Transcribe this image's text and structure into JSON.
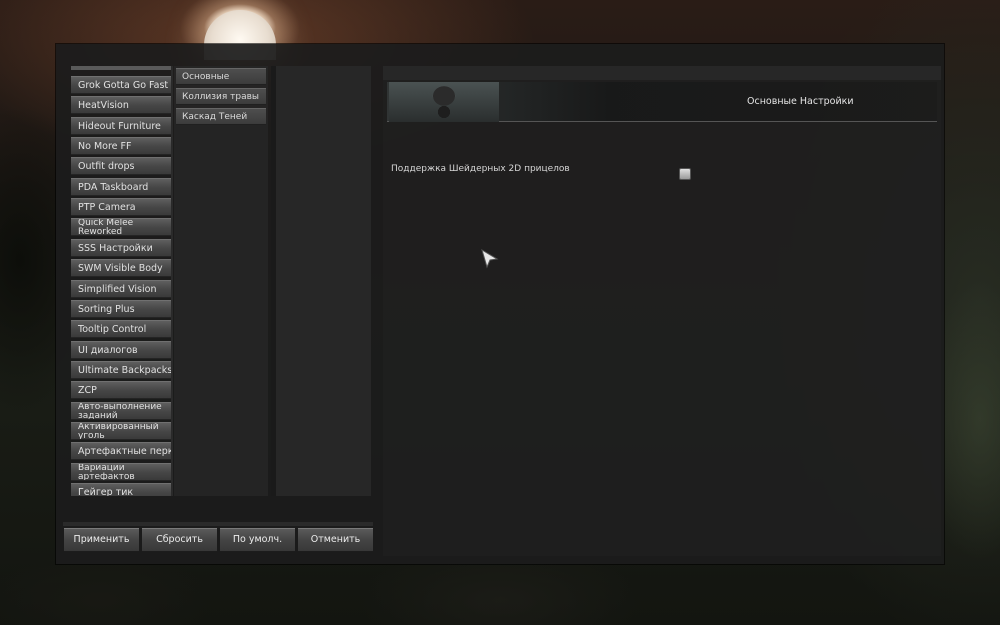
{
  "mods": [
    "Grok Gotta Go Fast",
    "HeatVision",
    "Hideout Furniture",
    "No More FF",
    "Outfit drops",
    "PDA Taskboard",
    "PTP Camera",
    [
      "Quick Melee",
      "Reworked"
    ],
    "SSS Настройки",
    "SWM Visible Body",
    "Simplified Vision",
    "Sorting Plus",
    "Tooltip Control",
    "UI диалогов",
    "Ultimate Backpacks",
    "ZCP",
    [
      "Авто-выполнение",
      "заданий"
    ],
    [
      "Активированный",
      "уголь"
    ],
    "Артефактные перки",
    [
      "Вариации",
      "артефактов"
    ],
    "Гейгер тик"
  ],
  "sub_categories": [
    "Основные",
    "Коллизия травы",
    "Каскад Теней"
  ],
  "panel": {
    "title": "Основные Настройки",
    "option_label": "Поддержка Шейдерных 2D прицелов",
    "option_checked": false
  },
  "footer": {
    "apply": "Применить",
    "reset": "Сбросить",
    "defaults": "По умолч.",
    "cancel": "Отменить"
  },
  "icons": {
    "cursor": "arrow-pointer-icon",
    "banner": "gas-mask-icon"
  }
}
